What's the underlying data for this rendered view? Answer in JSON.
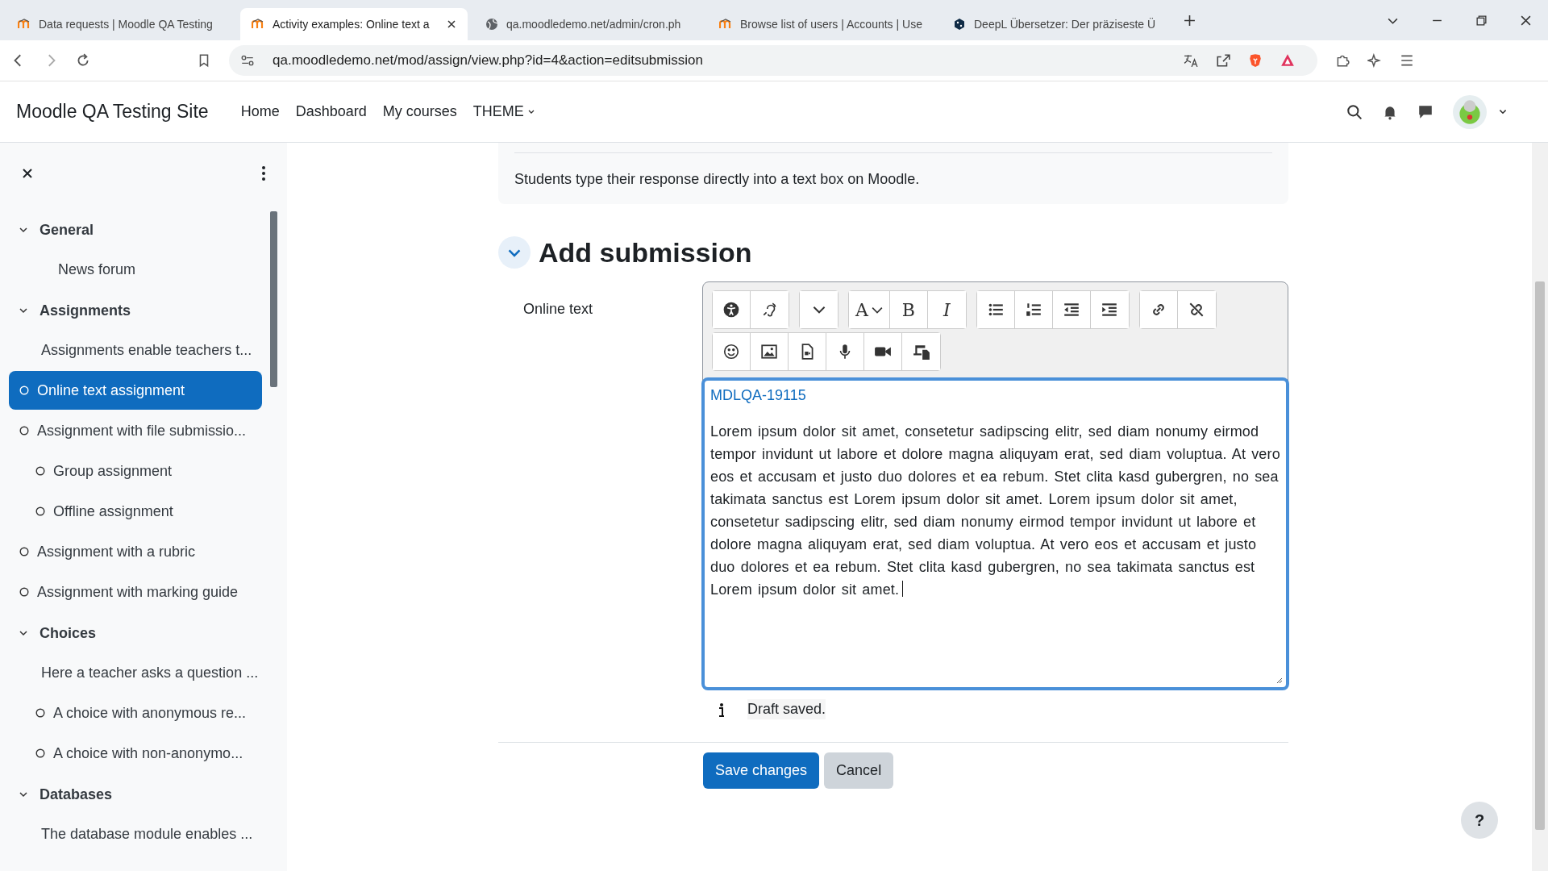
{
  "browser": {
    "tabs": [
      {
        "title": "Data requests | Moodle QA Testing",
        "kind": "moodle",
        "selected": false
      },
      {
        "title": "Activity examples: Online text a",
        "kind": "moodle",
        "selected": true
      },
      {
        "title": "qa.moodledemo.net/admin/cron.ph",
        "kind": "globe",
        "selected": false
      },
      {
        "title": "Browse list of users | Accounts | Use",
        "kind": "moodle",
        "selected": false
      },
      {
        "title": "DeepL Übersetzer: Der präziseste Ü",
        "kind": "deepl",
        "selected": false
      }
    ],
    "address": "qa.moodledemo.net/mod/assign/view.php?id=4&action=editsubmission"
  },
  "navbar": {
    "site_name": "Moodle QA Testing Site",
    "links": [
      {
        "label": "Home",
        "dropdown": false
      },
      {
        "label": "Dashboard",
        "dropdown": false
      },
      {
        "label": "My courses",
        "dropdown": false
      },
      {
        "label": "THEME",
        "dropdown": true
      }
    ]
  },
  "sidebar": {
    "sections": [
      {
        "title": "General",
        "expanded": true,
        "items": [
          {
            "label": "News forum",
            "kind": "forum",
            "selected": false
          }
        ]
      },
      {
        "title": "Assignments",
        "expanded": true,
        "items": [
          {
            "label": "Assignments enable teachers t...",
            "kind": "label",
            "selected": false
          },
          {
            "label": "Online text assignment",
            "kind": "activity",
            "selected": true
          },
          {
            "label": "Assignment with file submissio...",
            "kind": "activity",
            "selected": false,
            "children": [
              {
                "label": "Group assignment",
                "kind": "activity",
                "selected": false
              },
              {
                "label": "Offline assignment",
                "kind": "activity",
                "selected": false
              }
            ]
          },
          {
            "label": "Assignment with a rubric",
            "kind": "activity",
            "selected": false
          },
          {
            "label": "Assignment with marking guide",
            "kind": "activity",
            "selected": false
          }
        ]
      },
      {
        "title": "Choices",
        "expanded": true,
        "items": [
          {
            "label": "Here a teacher asks a question ...",
            "kind": "label",
            "selected": false,
            "children": [
              {
                "label": "A choice with anonymous re...",
                "kind": "activity",
                "selected": false
              },
              {
                "label": "A choice with non-anonymo...",
                "kind": "activity",
                "selected": false
              }
            ]
          }
        ]
      },
      {
        "title": "Databases",
        "expanded": true,
        "items": [
          {
            "label": "The database module enables ...",
            "kind": "label",
            "selected": false
          }
        ]
      }
    ]
  },
  "intro": "Students type their response directly into a text box on Moodle.",
  "submission": {
    "heading": "Add submission",
    "expanded": true,
    "field_label": "Online text",
    "toolbar": [
      [
        [
          {
            "kind": "accessibility"
          },
          {
            "kind": "ear"
          }
        ],
        [
          {
            "kind": "more"
          }
        ],
        [
          {
            "kind": "font",
            "glyph": "A"
          },
          {
            "kind": "bold",
            "glyph": "B"
          },
          {
            "kind": "italic",
            "glyph": "I"
          }
        ],
        [
          {
            "kind": "bullets"
          },
          {
            "kind": "numbers"
          },
          {
            "kind": "outdent"
          },
          {
            "kind": "indent"
          }
        ],
        [
          {
            "kind": "link"
          },
          {
            "kind": "unlink"
          }
        ]
      ],
      [
        [
          {
            "kind": "emoji"
          },
          {
            "kind": "image"
          },
          {
            "kind": "media"
          },
          {
            "kind": "mic"
          },
          {
            "kind": "video"
          },
          {
            "kind": "files"
          }
        ]
      ]
    ],
    "content_title": "MDLQA-19115",
    "content": "Lorem ipsum dolor sit amet, consetetur sadipscing elitr, sed diam nonumy eirmod tempor invidunt ut labore et dolore magna aliquyam erat, sed diam voluptua. At vero eos et accusam et justo duo dolores et ea rebum. Stet clita kasd gubergren, no sea takimata sanctus est Lorem ipsum dolor sit amet. Lorem ipsum dolor sit amet, consetetur sadipscing elitr, sed diam nonumy eirmod tempor invidunt ut labore et dolore magna aliquyam erat, sed diam voluptua. At vero eos et accusam et justo duo dolores et ea rebum. Stet clita kasd gubergren, no sea takimata sanctus est Lorem ipsum dolor sit amet.",
    "status": "Draft saved.",
    "buttons": [
      {
        "label": "Save changes",
        "kind": "primary"
      },
      {
        "label": "Cancel",
        "kind": "secondary"
      }
    ]
  },
  "help": "?"
}
